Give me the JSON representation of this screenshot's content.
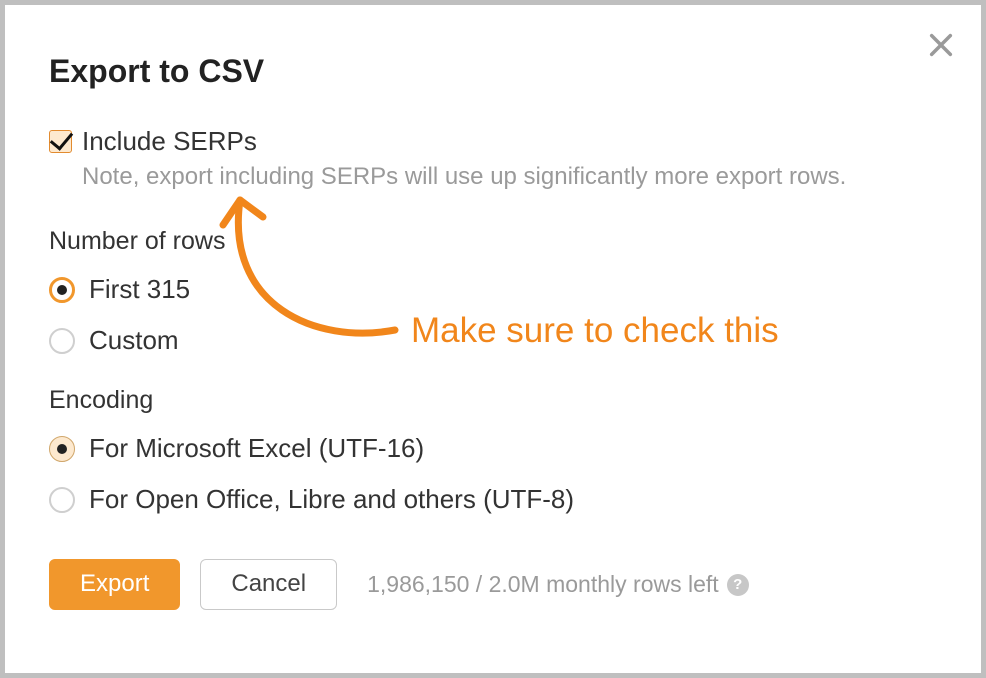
{
  "modal": {
    "title": "Export to CSV",
    "close_aria": "Close"
  },
  "include_serps": {
    "label": "Include SERPs",
    "note": "Note, export including SERPs will use up significantly more export rows.",
    "checked": true
  },
  "rows": {
    "section_label": "Number of rows",
    "options": [
      {
        "label": "First 315",
        "selected": true
      },
      {
        "label": "Custom",
        "selected": false
      }
    ]
  },
  "encoding": {
    "section_label": "Encoding",
    "options": [
      {
        "label": "For Microsoft Excel (UTF-16)",
        "selected": true
      },
      {
        "label": "For Open Office, Libre and others (UTF-8)",
        "selected": false
      }
    ]
  },
  "footer": {
    "export_label": "Export",
    "cancel_label": "Cancel",
    "quota_text": "1,986,150 / 2.0M monthly rows left",
    "help_glyph": "?"
  },
  "annotation": {
    "text": "Make sure to check this"
  },
  "colors": {
    "accent": "#f1972c",
    "annotation": "#f1861b"
  }
}
